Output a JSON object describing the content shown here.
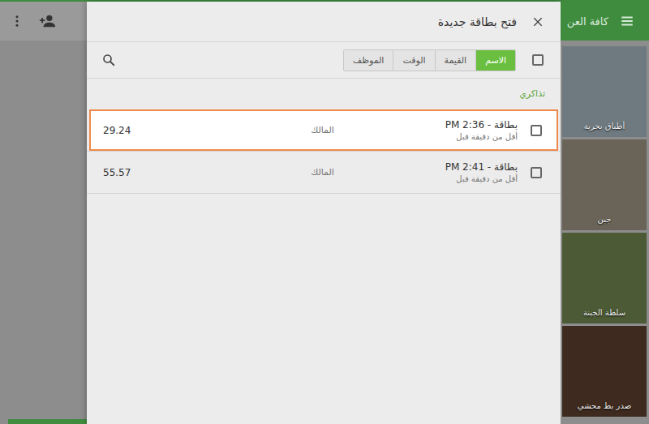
{
  "app_bar": {
    "title": "كافة العن"
  },
  "categories": [
    {
      "label": "أطباق بحرية"
    },
    {
      "label": "جبن"
    },
    {
      "label": "سلطة الجبنة"
    },
    {
      "label": "صدر بط محشي"
    }
  ],
  "dialog": {
    "title": "فتح بطاقة جديدة",
    "select_all": {
      "checked": false
    },
    "sort_tabs": [
      {
        "label": "الاسم",
        "selected": true
      },
      {
        "label": "القيمة",
        "selected": false
      },
      {
        "label": "الوقت",
        "selected": false
      },
      {
        "label": "الموظف",
        "selected": false
      }
    ],
    "section": "تذاكري",
    "tickets": [
      {
        "name": "بطاقة - 2:36 PM",
        "age": "أقل من دقيقة قبل",
        "employee": "المالك",
        "amount": "29.24",
        "checked": false,
        "highlighted": true
      },
      {
        "name": "بطاقة - 2:41 PM",
        "age": "أقل من دقيقة قبل",
        "employee": "المالك",
        "amount": "55.57",
        "checked": false,
        "highlighted": false
      }
    ]
  }
}
